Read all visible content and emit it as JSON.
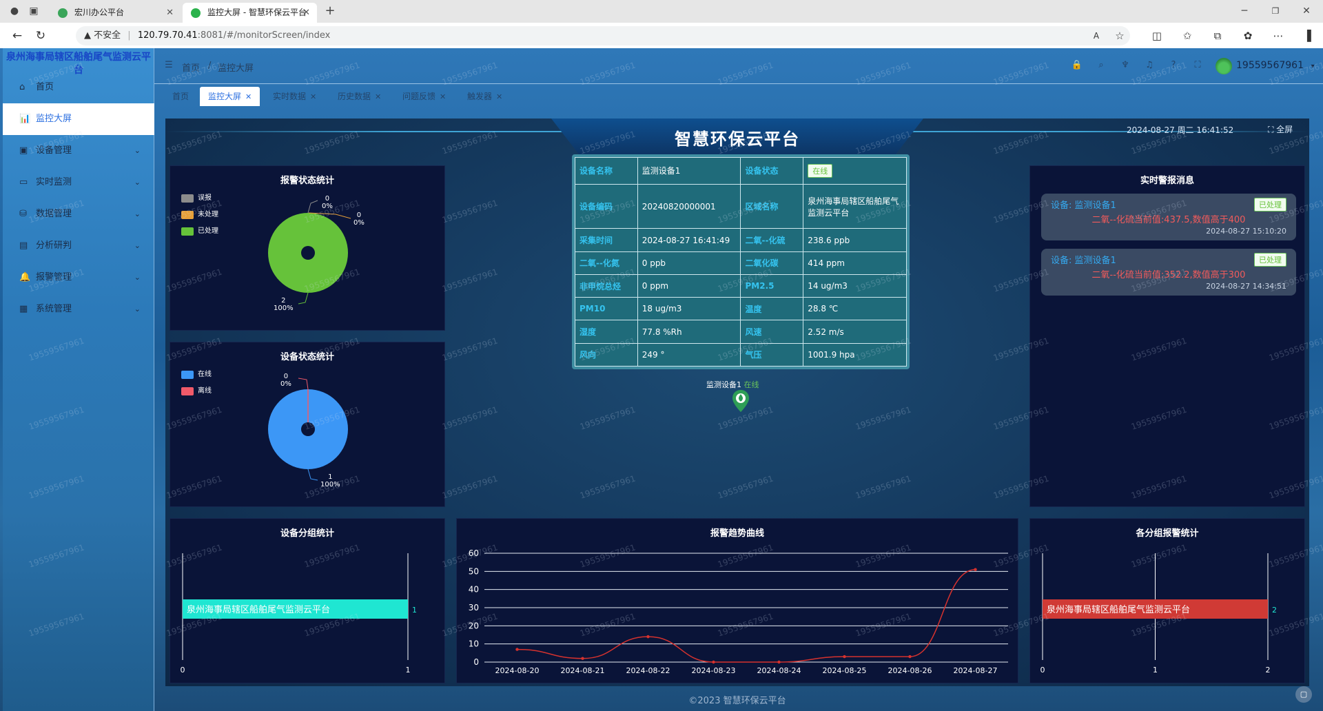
{
  "browser": {
    "tabs": [
      {
        "title": "宏川办公平台",
        "active": false
      },
      {
        "title": "监控大屏 - 智慧环保云平台",
        "active": true
      }
    ],
    "new_tab": "+",
    "address": {
      "security": "不安全",
      "host": "120.79.70.41",
      "rest": ":8081/#/monitorScreen/index"
    }
  },
  "sidebar": {
    "brand": "泉州海事局辖区船舶尾气监测云平台",
    "items": [
      {
        "label": "首页",
        "icon": "home-icon",
        "glyph": "⌂",
        "expandable": false,
        "active": false
      },
      {
        "label": "监控大屏",
        "icon": "bar-chart-icon",
        "glyph": "📊",
        "expandable": false,
        "active": true
      },
      {
        "label": "设备管理",
        "icon": "briefcase-icon",
        "glyph": "▣",
        "expandable": true,
        "active": false
      },
      {
        "label": "实时监测",
        "icon": "monitor-icon",
        "glyph": "▭",
        "expandable": true,
        "active": false
      },
      {
        "label": "数据管理",
        "icon": "database-icon",
        "glyph": "⛁",
        "expandable": true,
        "active": false
      },
      {
        "label": "分析研判",
        "icon": "analysis-icon",
        "glyph": "▤",
        "expandable": true,
        "active": false
      },
      {
        "label": "报警管理",
        "icon": "bell-icon",
        "glyph": "🔔",
        "expandable": true,
        "active": false
      },
      {
        "label": "系统管理",
        "icon": "settings-icon",
        "glyph": "▦",
        "expandable": true,
        "active": false
      }
    ]
  },
  "topbar": {
    "breadcrumb": [
      "首页",
      "/",
      "监控大屏"
    ],
    "user": "19559567961"
  },
  "page_tabs": [
    {
      "label": "首页",
      "closable": false,
      "active": false
    },
    {
      "label": "监控大屏",
      "closable": true,
      "active": true
    },
    {
      "label": "实时数据",
      "closable": true,
      "active": false
    },
    {
      "label": "历史数据",
      "closable": true,
      "active": false
    },
    {
      "label": "问题反馈",
      "closable": true,
      "active": false
    },
    {
      "label": "触发器",
      "closable": true,
      "active": false
    }
  ],
  "screen": {
    "title": "智慧环保云平台",
    "datetime": "2024-08-27 周二 16:41:52",
    "fullscreen": "全屏",
    "alarm_status": {
      "title": "报警状态统计",
      "legend": [
        {
          "label": "误报",
          "color": "#8c8c8c"
        },
        {
          "label": "未处理",
          "color": "#e8a038"
        },
        {
          "label": "已处理",
          "color": "#66c23a"
        }
      ],
      "labels": {
        "a_count": "0",
        "a_pct": "0%",
        "b_count": "0",
        "b_pct": "0%",
        "c_count": "2",
        "c_pct": "100%"
      }
    },
    "device_status": {
      "title": "设备状态统计",
      "legend": [
        {
          "label": "在线",
          "color": "#3c97f6"
        },
        {
          "label": "离线",
          "color": "#f05a6a"
        }
      ],
      "labels": {
        "a_count": "0",
        "a_pct": "0%",
        "b_count": "1",
        "b_pct": "100%"
      }
    },
    "device_info": {
      "rows": [
        [
          "设备名称",
          "监测设备1",
          "设备状态",
          "在线"
        ],
        [
          "设备编码",
          "20240820000001",
          "区域名称",
          "泉州海事局辖区船舶尾气监测云平台"
        ],
        [
          "采集时间",
          "2024-08-27 16:41:49",
          "二氧--化硫",
          "238.6 ppb"
        ],
        [
          "二氧--化氮",
          "0 ppb",
          "二氧化碳",
          "414 ppm"
        ],
        [
          "非甲烷总烃",
          "0 ppm",
          "PM2.5",
          "14 ug/m3"
        ],
        [
          "PM10",
          "18 ug/m3",
          "温度",
          "28.8 ℃"
        ],
        [
          "湿度",
          "77.8 %Rh",
          "风速",
          "2.52 m/s"
        ],
        [
          "风向",
          "249 °",
          "气压",
          "1001.9 hpa"
        ]
      ]
    },
    "marker": {
      "name": "监测设备1",
      "status": "在线"
    },
    "realtime_alarms": {
      "title": "实时警报消息",
      "items": [
        {
          "device": "设备: 监测设备1",
          "tag": "已处理",
          "message": "二氧--化硫当前值:437.5,数值高于400",
          "time": "2024-08-27 15:10:20"
        },
        {
          "device": "设备: 监测设备1",
          "tag": "已处理",
          "message": "二氧--化硫当前值:352.2,数值高于300",
          "time": "2024-08-27 14:34:51"
        }
      ]
    },
    "footer": "©2023 智慧环保云平台",
    "watermark": "19559567961"
  },
  "chart_data": [
    {
      "type": "pie",
      "title": "报警状态统计",
      "categories": [
        "误报",
        "未处理",
        "已处理"
      ],
      "values": [
        0,
        0,
        2
      ],
      "colors": [
        "#8c8c8c",
        "#e8a038",
        "#66c23a"
      ]
    },
    {
      "type": "pie",
      "title": "设备状态统计",
      "categories": [
        "在线",
        "离线"
      ],
      "values": [
        1,
        0
      ],
      "colors": [
        "#3c97f6",
        "#f05a6a"
      ]
    },
    {
      "type": "bar",
      "orientation": "horizontal",
      "title": "设备分组统计",
      "categories": [
        "泉州海事局辖区船舶尾气监测云平台"
      ],
      "values": [
        1
      ],
      "xlim": [
        0,
        1
      ],
      "x_ticks": [
        "0",
        "1"
      ],
      "color": "#1fe6d2"
    },
    {
      "type": "line",
      "title": "报警趋势曲线",
      "x": [
        "2024-08-20",
        "2024-08-21",
        "2024-08-22",
        "2024-08-23",
        "2024-08-24",
        "2024-08-25",
        "2024-08-26",
        "2024-08-27"
      ],
      "values": [
        7,
        2,
        14,
        0,
        0,
        3,
        3,
        51
      ],
      "ylim": [
        0,
        60
      ],
      "y_ticks": [
        "0",
        "10",
        "20",
        "30",
        "40",
        "50",
        "60"
      ],
      "color": "#d6322e"
    },
    {
      "type": "bar",
      "orientation": "horizontal",
      "title": "各分组报警统计",
      "categories": [
        "泉州海事局辖区船舶尾气监测云平台"
      ],
      "values": [
        2
      ],
      "xlim": [
        0,
        2
      ],
      "x_ticks": [
        "0",
        "1",
        "2"
      ],
      "color": "#d03a35"
    }
  ]
}
